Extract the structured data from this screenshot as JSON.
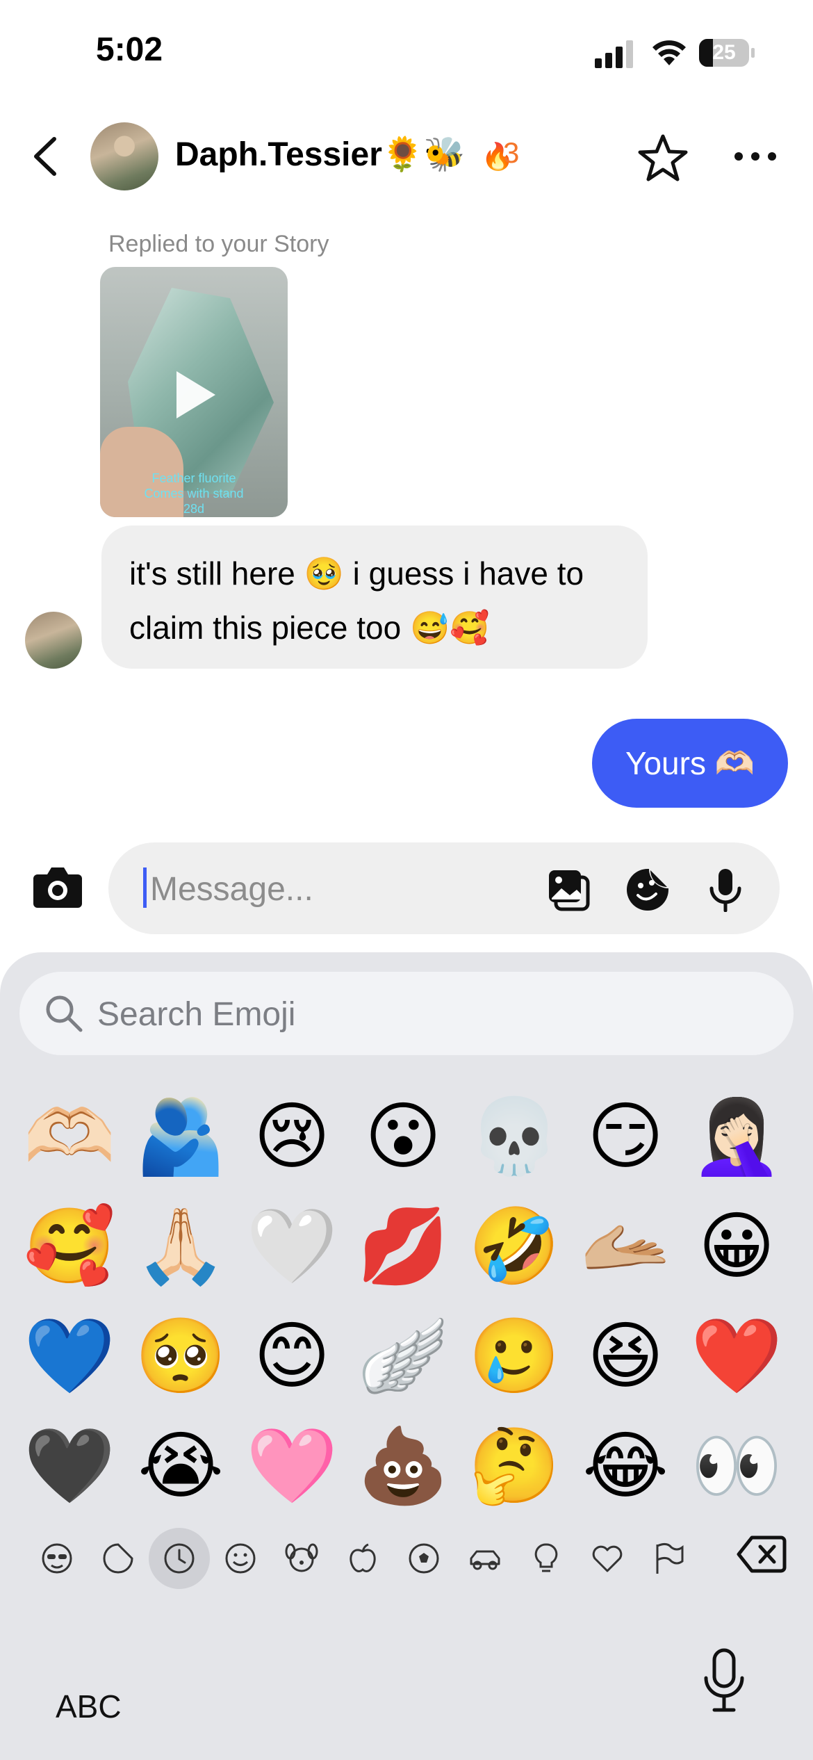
{
  "status_bar": {
    "time": "5:02",
    "battery": "25"
  },
  "header": {
    "name": "Daph.Tessier🌻🐝",
    "streak_emoji": "🔥",
    "streak_count": "3"
  },
  "story": {
    "label": "Replied to your Story",
    "caption_line1": "Feather fluorite",
    "caption_line2": "Comes with stand",
    "caption_age": "28d"
  },
  "messages": [
    {
      "from": "them",
      "text": "it's still here 🥹 i guess i have to claim this piece too 😅🥰"
    },
    {
      "from": "me",
      "text": "Yours 🫶🏻"
    }
  ],
  "composer": {
    "placeholder": "Message..."
  },
  "keyboard": {
    "search_placeholder": "Search Emoji",
    "emojis": [
      [
        "🫶🏻",
        "🫂",
        "😢",
        "😮",
        "💀",
        "😏",
        "🤦🏻‍♀️"
      ],
      [
        "🥰",
        "🙏🏻",
        "🤍",
        "💋",
        "🤣",
        "🫴🏼",
        "😀"
      ],
      [
        "💙",
        "🥺",
        "😊",
        "🪽",
        "🥲",
        "😆",
        "❤️"
      ],
      [
        "🖤",
        "😭",
        "🩷",
        "💩",
        "🤔",
        "😂",
        "👀"
      ]
    ],
    "categories": [
      "memoji-icon",
      "sticker-icon",
      "recent-clock-icon",
      "smiley-icon",
      "animal-icon",
      "food-apple-icon",
      "soccer-ball-icon",
      "car-icon",
      "lightbulb-icon",
      "heart-icon",
      "flag-icon"
    ],
    "abc_label": "ABC"
  },
  "colors": {
    "accent": "#3d5cf5",
    "streak": "#f4762a",
    "keyboard_bg": "#e4e5e9"
  }
}
